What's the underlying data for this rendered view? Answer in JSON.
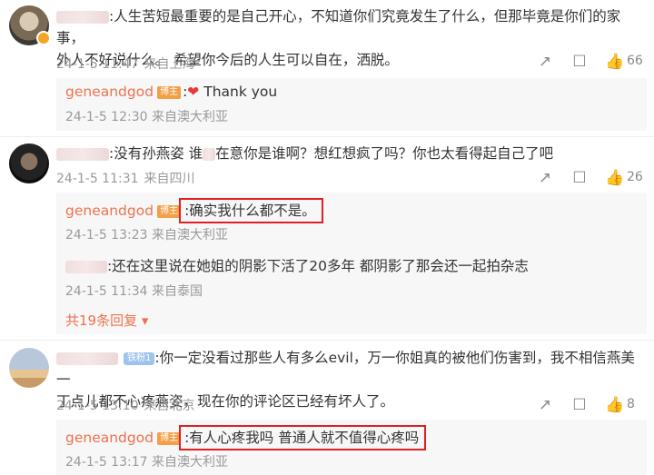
{
  "comments": [
    {
      "text_line1": ":人生苦短最重要的是自己开心，不知道你们究竟发生了什么，但那毕竟是你们的家事，",
      "text_line2": "外人不好说什么。 希望你今后的人生可以自在，洒脱。",
      "date": "24-1-5 11:47",
      "location": "来自上海",
      "like_count": "66",
      "reply": {
        "username": "geneandgod",
        "tag": "博主",
        "text": "Thank you",
        "date": "24-1-5 12:30",
        "location": "来自澳大利亚"
      }
    },
    {
      "text_part1": ":没有孙燕姿 谁",
      "text_part2": "在意你是谁啊？想红想疯了吗？你也太看得起自己了吧",
      "date": "24-1-5 11:31",
      "location": "来自四川",
      "like_count": "26",
      "replies": [
        {
          "username": "geneandgod",
          "tag": "博主",
          "text": ":确实我什么都不是。",
          "date": "24-1-5 13:23",
          "location": "来自澳大利亚"
        },
        {
          "text": ":还在这里说在她姐的阴影下活了20多年 都阴影了那会还一起拍杂志",
          "date": "24-1-5 11:34",
          "location": "来自泰国"
        }
      ],
      "more_replies": "共19条回复"
    },
    {
      "fan_badge": "铁粉1",
      "text_line1": ":你一定没看过那些人有多么evil，万一你姐真的被他们伤害到，我不相信燕美一",
      "text_line2": "丁点儿都不心疼燕姿，现在你的评论区已经有坏人了。",
      "date": "24-1-5 13:10",
      "location": "来自北京",
      "like_count": "8",
      "reply": {
        "username": "geneandgod",
        "tag": "博主",
        "text": ":有人心疼我吗 普通人就不值得心疼吗",
        "date": "24-1-5 13:17",
        "location": "来自澳大利亚"
      }
    }
  ],
  "colors": {
    "username": "#eb7350",
    "highlight_border": "#e02020",
    "meta": "#999999"
  }
}
